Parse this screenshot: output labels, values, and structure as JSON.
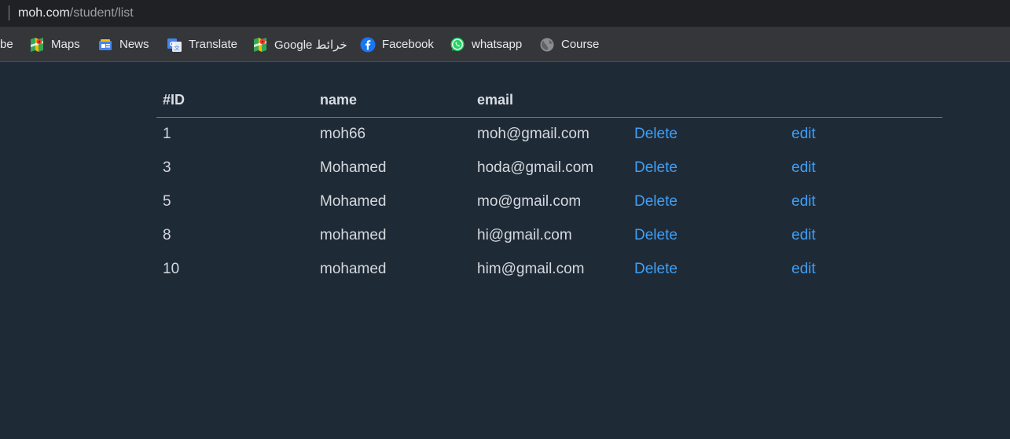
{
  "browser": {
    "url_host": "moh.com",
    "url_path": "/student/list",
    "bookmarks": [
      {
        "label": "be",
        "icon": ""
      },
      {
        "label": "Maps",
        "icon": "google-maps-icon"
      },
      {
        "label": "News",
        "icon": "google-news-icon"
      },
      {
        "label": "Translate",
        "icon": "google-translate-icon"
      },
      {
        "label": "Google خرائط",
        "icon": "google-maps-icon"
      },
      {
        "label": "Facebook",
        "icon": "facebook-icon"
      },
      {
        "label": "whatsapp",
        "icon": "whatsapp-icon"
      },
      {
        "label": "Course",
        "icon": "globe-icon"
      }
    ]
  },
  "table": {
    "headers": {
      "id": "#ID",
      "name": "name",
      "email": "email"
    },
    "rows": [
      {
        "id": "1",
        "name": "moh66",
        "email": "moh@gmail.com",
        "delete": "Delete",
        "edit": "edit"
      },
      {
        "id": "3",
        "name": "Mohamed",
        "email": "hoda@gmail.com",
        "delete": "Delete",
        "edit": "edit"
      },
      {
        "id": "5",
        "name": "Mohamed",
        "email": "mo@gmail.com",
        "delete": "Delete",
        "edit": "edit"
      },
      {
        "id": "8",
        "name": "mohamed",
        "email": "hi@gmail.com",
        "delete": "Delete",
        "edit": "edit"
      },
      {
        "id": "10",
        "name": "mohamed",
        "email": "him@gmail.com",
        "delete": "Delete",
        "edit": "edit"
      }
    ]
  },
  "colors": {
    "page_bg": "#1f2a37",
    "link": "#3fa0f5",
    "toolbar": "#35363a"
  }
}
